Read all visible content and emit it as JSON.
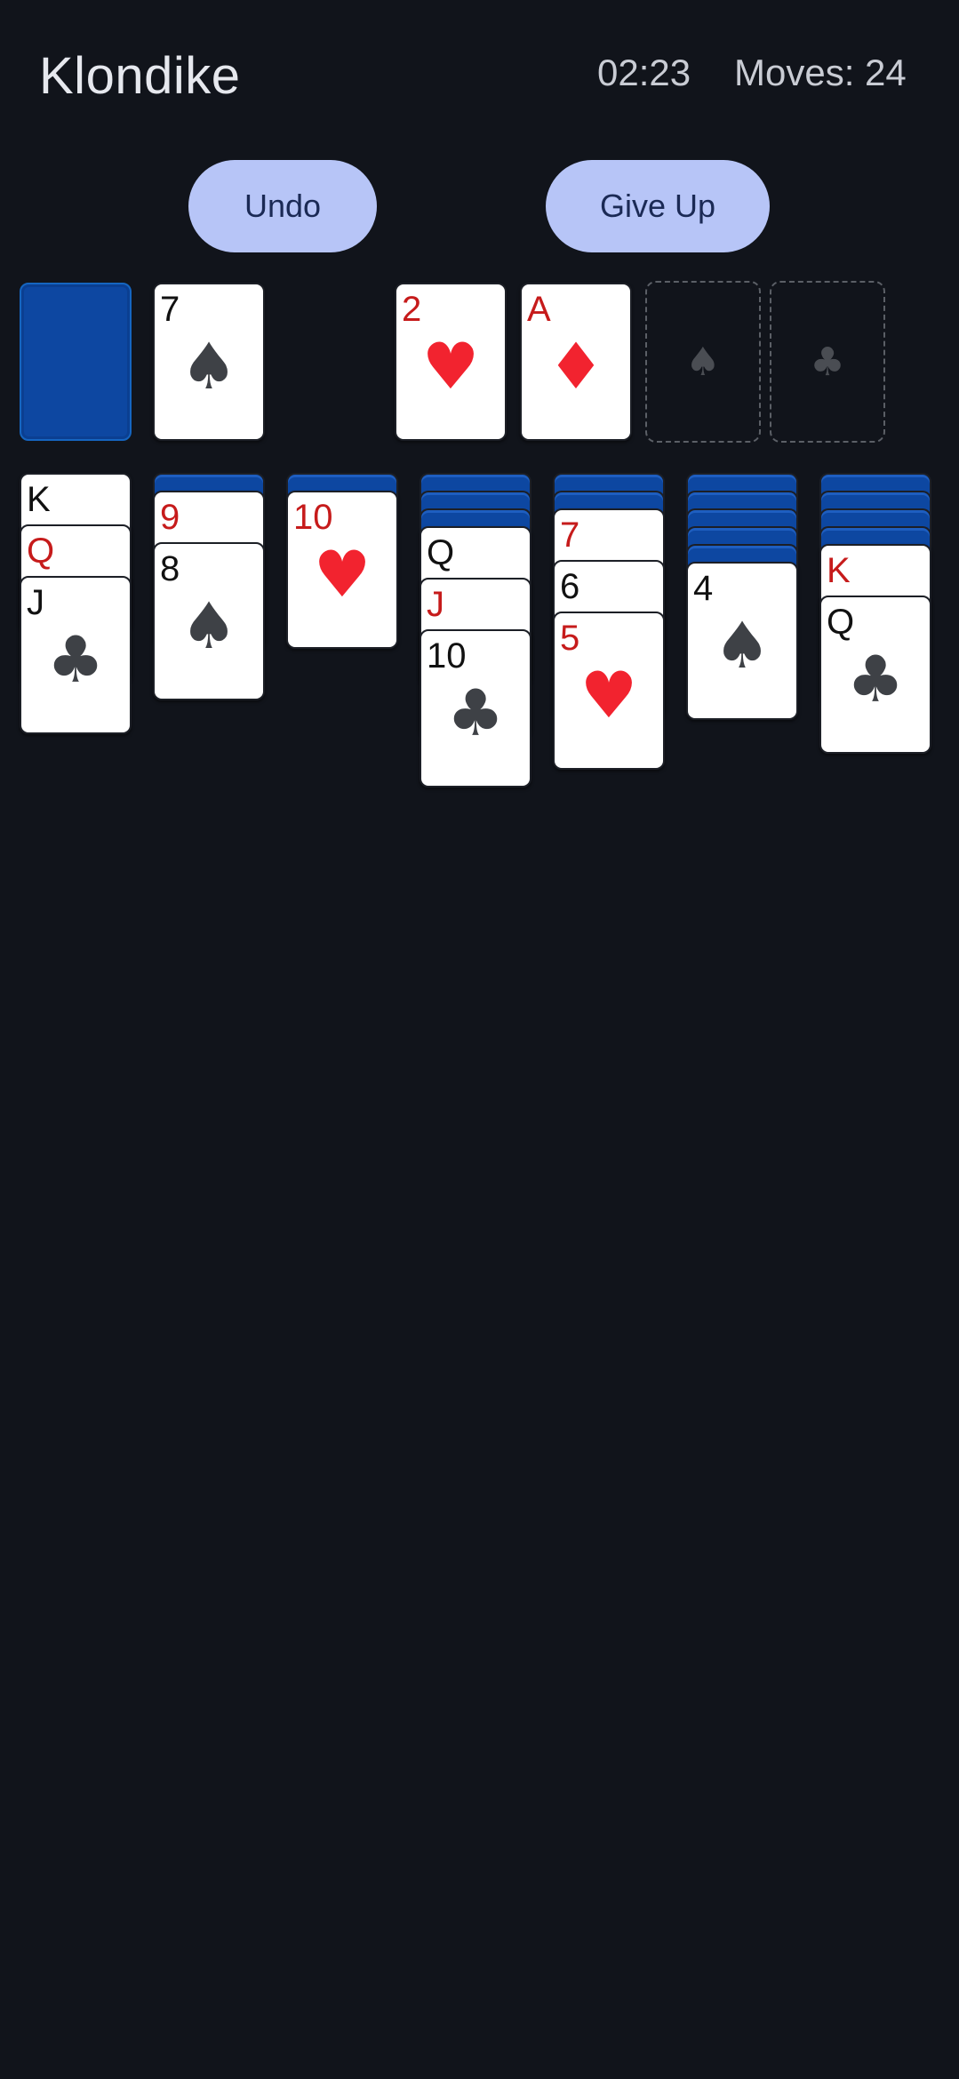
{
  "header": {
    "title": "Klondike",
    "timer": "02:23",
    "moves": "Moves: 24"
  },
  "actions": {
    "undo_label": "Undo",
    "giveup_label": "Give Up"
  },
  "stock": {
    "face_down": true
  },
  "waste": {
    "rank": "7",
    "suit": "♠",
    "color": "black"
  },
  "foundations": [
    {
      "rank": "2",
      "suit": "♥",
      "color": "red"
    },
    {
      "rank": "A",
      "suit": "♦",
      "color": "red"
    },
    {
      "placeholder_suit": "♠"
    },
    {
      "placeholder_suit": "♣"
    }
  ],
  "tableau": [
    {
      "hidden": 0,
      "cards": [
        {
          "rank": "K",
          "suit": "♣",
          "color": "black"
        },
        {
          "rank": "Q",
          "suit": "♥",
          "color": "red"
        },
        {
          "rank": "J",
          "suit": "♣",
          "color": "black"
        }
      ]
    },
    {
      "hidden": 1,
      "cards": [
        {
          "rank": "9",
          "suit": "♥",
          "color": "red"
        },
        {
          "rank": "8",
          "suit": "♠",
          "color": "black"
        }
      ]
    },
    {
      "hidden": 1,
      "cards": [
        {
          "rank": "10",
          "suit": "♥",
          "color": "red"
        }
      ]
    },
    {
      "hidden": 3,
      "cards": [
        {
          "rank": "Q",
          "suit": "♠",
          "color": "black"
        },
        {
          "rank": "J",
          "suit": "♥",
          "color": "red"
        },
        {
          "rank": "10",
          "suit": "♣",
          "color": "black"
        }
      ]
    },
    {
      "hidden": 2,
      "cards": [
        {
          "rank": "7",
          "suit": "♥",
          "color": "red"
        },
        {
          "rank": "6",
          "suit": "♠",
          "color": "black"
        },
        {
          "rank": "5",
          "suit": "♥",
          "color": "red"
        }
      ]
    },
    {
      "hidden": 5,
      "cards": [
        {
          "rank": "4",
          "suit": "♠",
          "color": "black"
        }
      ]
    },
    {
      "hidden": 4,
      "cards": [
        {
          "rank": "K",
          "suit": "♥",
          "color": "red"
        },
        {
          "rank": "Q",
          "suit": "♣",
          "color": "black"
        }
      ]
    }
  ],
  "colors": {
    "background": "#11141b",
    "button_bg": "#b7c5f7",
    "card_back": "#0d47a1",
    "red_suit": "#f2232f"
  }
}
